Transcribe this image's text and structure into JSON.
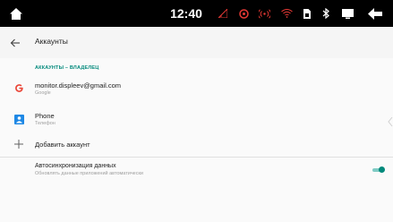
{
  "status_bar": {
    "time": "12:40",
    "icons": [
      "home-icon",
      "no-signal-icon",
      "vpn-icon",
      "hotspot-icon",
      "wifi-icon",
      "sim-icon",
      "bluetooth-icon",
      "screen-icon",
      "back-icon"
    ],
    "accent": "#e53935"
  },
  "app_bar": {
    "title": "Аккаунты",
    "back_icon": "arrow-left-icon"
  },
  "section": {
    "header": "АККАУНТЫ – ВЛАДЕЛЕЦ",
    "color": "#00897b"
  },
  "accounts": [
    {
      "title": "monitor.displeev@gmail.com",
      "subtitle": "Google",
      "icon": "google-icon"
    },
    {
      "title": "Phone",
      "subtitle": "Телефон",
      "icon": "phone-account-icon"
    }
  ],
  "add_account": {
    "label": "Добавить аккаунт",
    "icon": "plus-icon"
  },
  "auto_sync": {
    "title": "Автосинхронизация данных",
    "subtitle": "Обновлять данные приложений автоматически",
    "enabled": true,
    "toggle_color": "#00897b"
  }
}
